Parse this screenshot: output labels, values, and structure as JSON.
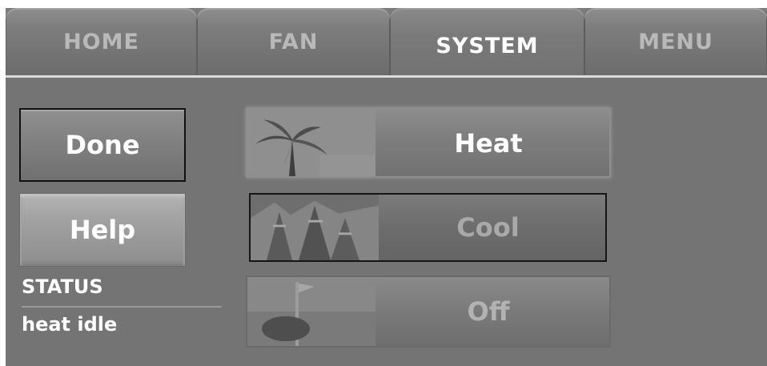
{
  "tabs": {
    "home": "HOME",
    "fan": "FAN",
    "system": "SYSTEM",
    "menu": "MENU",
    "active": "system"
  },
  "sidebar": {
    "done_label": "Done",
    "help_label": "Help",
    "status_label": "STATUS",
    "status_value": "heat idle"
  },
  "modes": {
    "heat": {
      "label": "Heat",
      "scene_icon": "palm-tree-icon"
    },
    "cool": {
      "label": "Cool",
      "scene_icon": "snowy-pine-icon"
    },
    "off": {
      "label": "Off",
      "scene_icon": "flag-icon"
    }
  },
  "colors": {
    "screen_bg": "#747474",
    "active_text": "#ffffff",
    "inactive_text": "#b9b9b9",
    "selected_border": "#111111"
  }
}
